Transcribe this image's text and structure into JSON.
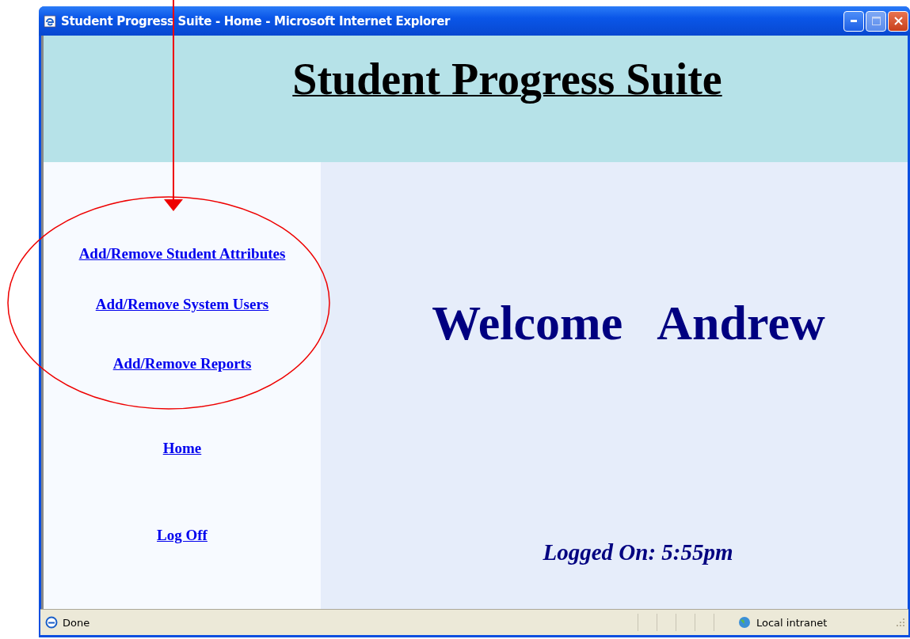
{
  "window": {
    "title": "Student Progress Suite - Home - Microsoft Internet Explorer"
  },
  "header": {
    "title": "Student Progress Suite"
  },
  "sidebar": {
    "links": [
      {
        "label": "Add/Remove Student Attributes"
      },
      {
        "label": "Add/Remove System Users"
      },
      {
        "label": "Add/Remove Reports"
      },
      {
        "label": "Home"
      },
      {
        "label": "Log Off"
      }
    ]
  },
  "main": {
    "welcome": "Welcome   Andrew",
    "logged_on": "Logged On: 5:55pm"
  },
  "status_bar": {
    "status": "Done",
    "zone": "Local intranet"
  }
}
